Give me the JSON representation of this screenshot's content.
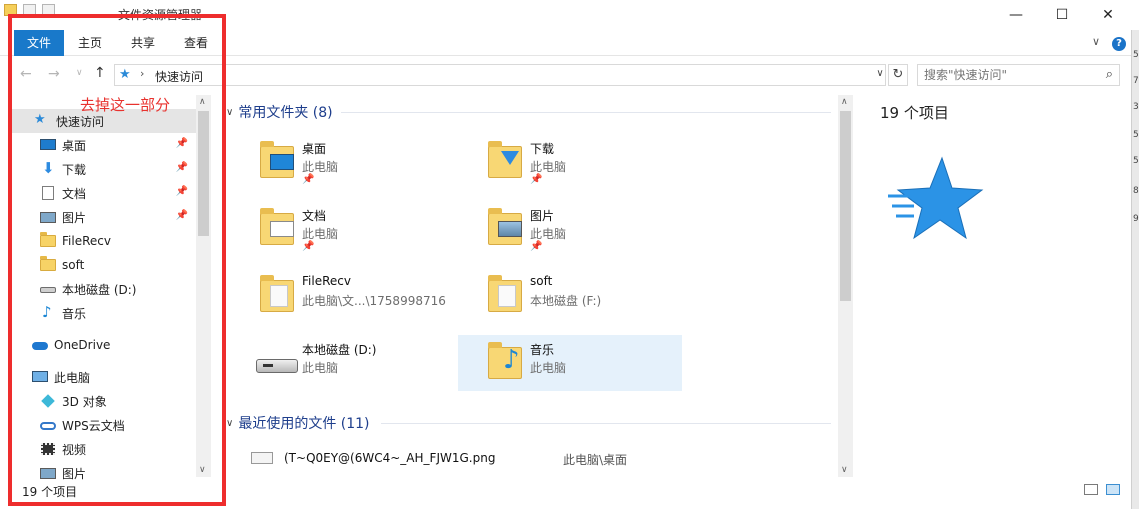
{
  "window": {
    "title": "文件资源管理器",
    "controls": {
      "minimize": "—",
      "maximize": "☐",
      "close": "✕"
    }
  },
  "ribbon": {
    "tabs": [
      "文件",
      "主页",
      "共享",
      "查看"
    ],
    "help": "?"
  },
  "address": {
    "crumb": "快速访问",
    "search_placeholder": "搜索\"快速访问\""
  },
  "annotation": "去掉这一部分",
  "nav": {
    "items": [
      {
        "label": "快速访问",
        "icon": "star-icon",
        "pinned": false,
        "selected": true
      },
      {
        "label": "桌面",
        "icon": "desktop-icon",
        "pinned": true
      },
      {
        "label": "下载",
        "icon": "download-icon",
        "pinned": true
      },
      {
        "label": "文档",
        "icon": "document-icon",
        "pinned": true
      },
      {
        "label": "图片",
        "icon": "pictures-icon",
        "pinned": true
      },
      {
        "label": "FileRecv",
        "icon": "folder-icon",
        "pinned": false
      },
      {
        "label": "soft",
        "icon": "folder-icon",
        "pinned": false
      },
      {
        "label": "本地磁盘 (D:)",
        "icon": "drive-icon",
        "pinned": false
      },
      {
        "label": "音乐",
        "icon": "music-icon",
        "pinned": false
      },
      {
        "label": "OneDrive",
        "icon": "onedrive-icon",
        "pinned": false
      },
      {
        "label": "此电脑",
        "icon": "computer-icon",
        "pinned": false
      },
      {
        "label": "3D 对象",
        "icon": "3d-objects-icon",
        "pinned": false
      },
      {
        "label": "WPS云文档",
        "icon": "wps-cloud-icon",
        "pinned": false
      },
      {
        "label": "视频",
        "icon": "video-icon",
        "pinned": false
      },
      {
        "label": "图片",
        "icon": "pictures-icon",
        "pinned": false
      }
    ],
    "footer": "19 个项目"
  },
  "content": {
    "frequent_header": "常用文件夹 (8)",
    "folders": [
      {
        "name": "桌面",
        "location": "此电脑",
        "pinned": true,
        "icon": "desktop-folder-icon"
      },
      {
        "name": "下载",
        "location": "此电脑",
        "pinned": true,
        "icon": "download-folder-icon"
      },
      {
        "name": "文档",
        "location": "此电脑",
        "pinned": true,
        "icon": "documents-folder-icon"
      },
      {
        "name": "图片",
        "location": "此电脑",
        "pinned": true,
        "icon": "pictures-folder-icon"
      },
      {
        "name": "FileRecv",
        "location": "此电脑\\文...\\1758998716",
        "pinned": false,
        "icon": "folder-icon"
      },
      {
        "name": "soft",
        "location": "本地磁盘 (F:)",
        "pinned": false,
        "icon": "folder-icon"
      },
      {
        "name": "本地磁盘 (D:)",
        "location": "此电脑",
        "pinned": false,
        "icon": "drive-icon"
      },
      {
        "name": "音乐",
        "location": "此电脑",
        "pinned": false,
        "icon": "music-folder-icon",
        "highlighted": true
      }
    ],
    "recent_header": "最近使用的文件 (11)",
    "recent": [
      {
        "name": "(T~Q0EY@(6WC4~_AH_FJW1G.png",
        "location": "此电脑\\桌面"
      }
    ]
  },
  "details": {
    "count": "19 个项目"
  },
  "colors": {
    "accent": "#1979ca",
    "annotation": "#ee2d2d",
    "group_header": "#1e3e8c",
    "highlight": "#e5f1fb"
  },
  "right_edge_glyphs": [
    "5",
    "7",
    "3",
    "5",
    "5",
    "8",
    "9"
  ]
}
